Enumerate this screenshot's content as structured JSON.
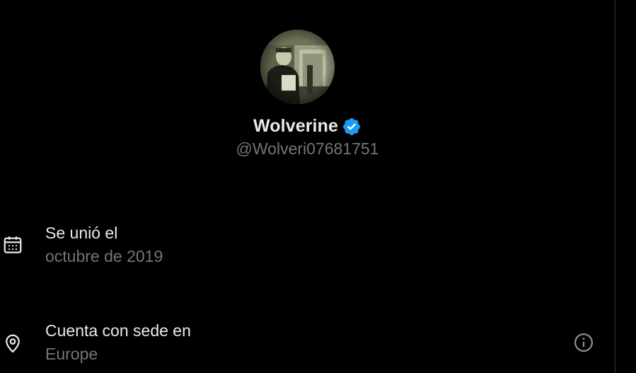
{
  "profile": {
    "display_name": "Wolverine",
    "handle": "@Wolveri07681751",
    "verified": true,
    "verified_icon": "verified-badge-icon",
    "avatar_icon": "avatar"
  },
  "joined": {
    "icon": "calendar-icon",
    "label": "Se unió el",
    "value": "octubre de 2019"
  },
  "location": {
    "icon": "location-pin-icon",
    "label": "Cuenta con sede en",
    "value": "Europe",
    "info_icon": "info-icon"
  },
  "colors": {
    "background": "#000000",
    "primary_text": "#e7e9ea",
    "secondary_text": "#71767b",
    "verified_blue": "#1d9bf0",
    "border": "#2f3336"
  }
}
